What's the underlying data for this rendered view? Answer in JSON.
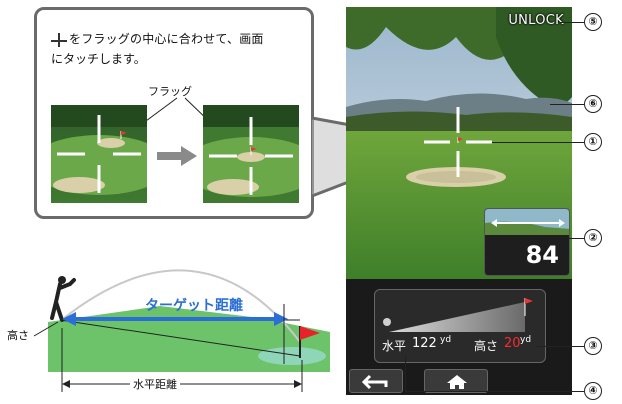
{
  "callout": {
    "line1": "をフラッグの中心に合わせて、画面",
    "line2": "にタッチします。",
    "flag_label": "フラッグ"
  },
  "diagram": {
    "target_label": "ターゲット距離",
    "height_label": "高さ",
    "horizontal_label": "水平距離"
  },
  "phone": {
    "unlock_label": "UNLOCK",
    "distance_value": "84",
    "horizontal": {
      "label": "水平",
      "value": "122",
      "unit": "yd"
    },
    "height": {
      "label": "高さ",
      "value": "20",
      "unit": "yd"
    },
    "colors": {
      "height_value": "#ff2a2a",
      "target_arrow": "#2b6fd6"
    }
  },
  "markers": [
    "①",
    "②",
    "③",
    "④",
    "⑤",
    "⑥"
  ],
  "icons": [
    "crosshair-icon",
    "flag-icon",
    "back-arrow-icon",
    "home-icon",
    "golfer-icon",
    "right-arrow-icon"
  ]
}
